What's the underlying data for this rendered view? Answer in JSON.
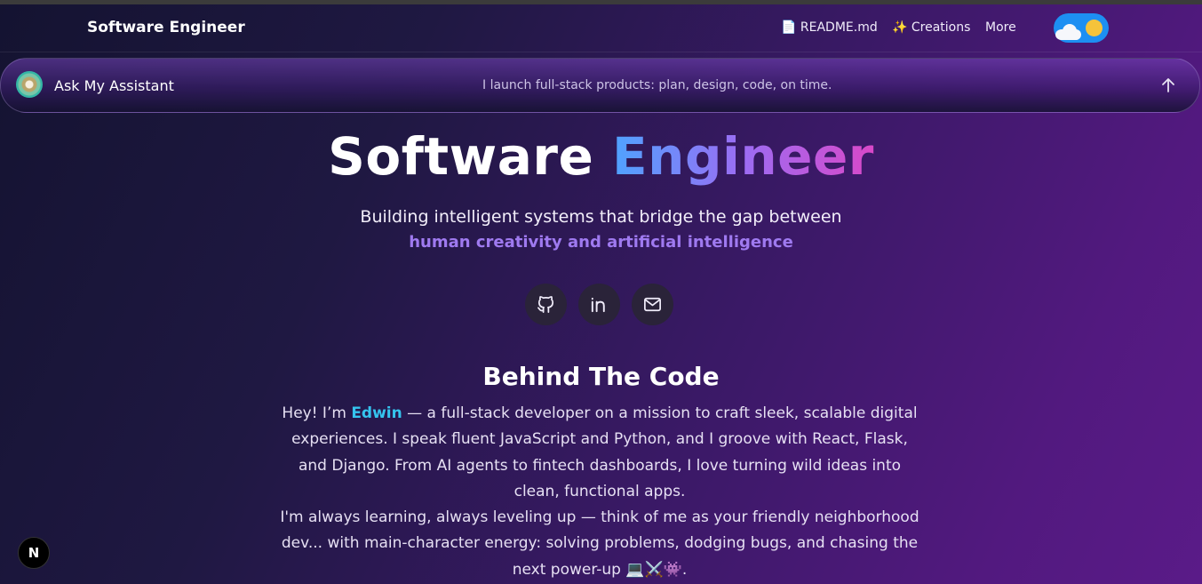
{
  "navbar": {
    "brand": "Software Engineer",
    "links": [
      {
        "label": "📄 README.md"
      },
      {
        "label": "✨ Creations"
      },
      {
        "label": "More"
      }
    ],
    "theme_toggle": {
      "icons": [
        "cloud-icon",
        "sun-icon"
      ]
    }
  },
  "assistant": {
    "label": "Ask My Assistant",
    "tagline": "I launch full-stack products: plan, design, code, on time."
  },
  "hero": {
    "title_plain": "Software",
    "title_gradient": "Engineer",
    "subtitle": "Building intelligent systems that bridge the gap between",
    "subtitle_accent": "human creativity and artificial intelligence"
  },
  "socials": [
    {
      "icon": "github-icon"
    },
    {
      "icon": "linkedin-icon"
    },
    {
      "icon": "mail-icon"
    }
  ],
  "about": {
    "heading": "Behind The Code",
    "greeting": "Hey! I’m",
    "name": "Edwin",
    "p1_rest": "— a full-stack developer on a mission to craft sleek, scalable digital experiences. I speak fluent JavaScript and Python, and I groove with React, Flask, and Django. From AI agents to fintech dashboards, I love turning wild ideas into clean, functional apps.",
    "p2": "I'm always learning, always leveling up — think of me as your friendly neighborhood dev... with main-character energy: solving problems, dodging bugs, and chasing the next power-up 💻⚔️👾."
  },
  "nextjs_badge": "N",
  "colors": {
    "accent_cyan": "#35c4ee",
    "accent_purple": "#9f7af0",
    "toggle_blue": "#1d8ff2",
    "sun_yellow": "#f5c33b"
  }
}
